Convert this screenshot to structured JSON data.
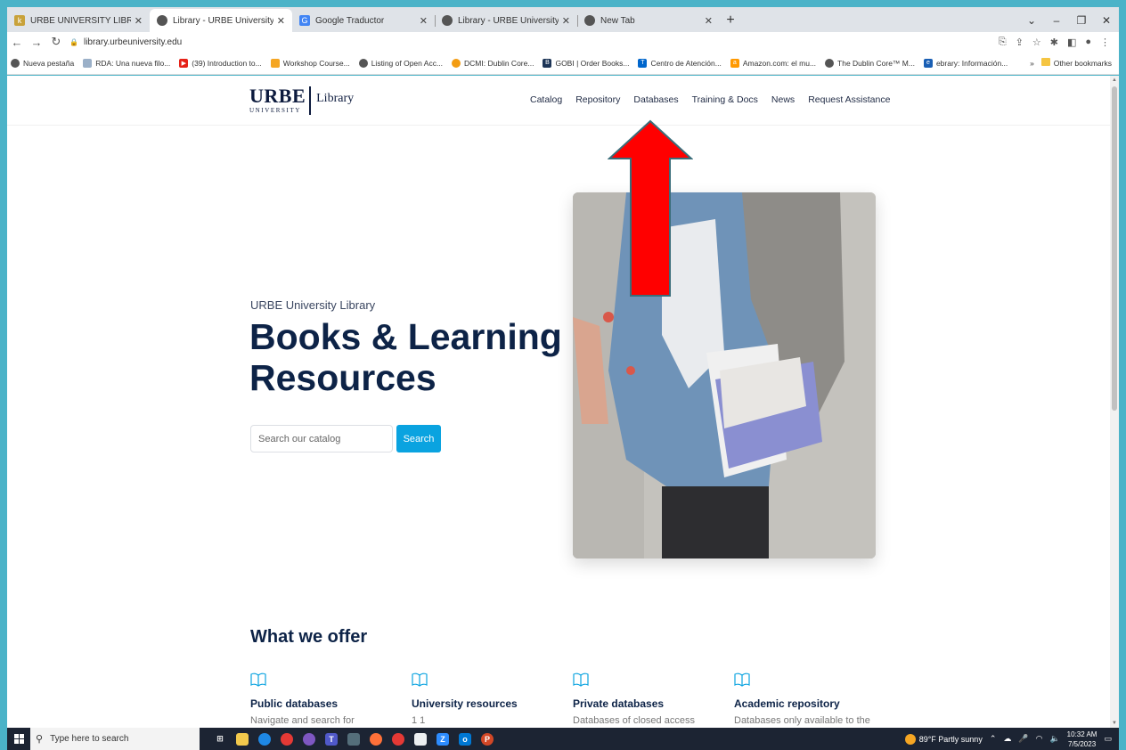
{
  "browser": {
    "tabs": [
      {
        "title": "URBE UNIVERSITY LIBRARY SYST",
        "icon": "k-favicon",
        "color": "#c8a23a",
        "active": false
      },
      {
        "title": "Library - URBE University",
        "icon": "globe-icon",
        "color": "#555555",
        "active": true
      },
      {
        "title": "Google Traductor",
        "icon": "translate-icon",
        "color": "#4285f4",
        "active": false
      },
      {
        "title": "Library - URBE University",
        "icon": "globe-icon",
        "color": "#555555",
        "active": false
      },
      {
        "title": "New Tab",
        "icon": "globe-icon",
        "color": "#555555",
        "active": false
      }
    ],
    "new_tab": "+",
    "address": "library.urbeuniversity.edu",
    "bookmarks": [
      {
        "label": "Nueva pestaña",
        "color": "#555555"
      },
      {
        "label": "RDA: Una nueva filo...",
        "color": "#9bb0c8"
      },
      {
        "label": "(39) Introduction to...",
        "color": "#e62117"
      },
      {
        "label": "Workshop Course...",
        "color": "#f5a623"
      },
      {
        "label": "Listing of Open Acc...",
        "color": "#555555"
      },
      {
        "label": "DCMI: Dublin Core...",
        "color": "#f39c12"
      },
      {
        "label": "GOBI | Order Books...",
        "color": "#1d3557"
      },
      {
        "label": "Centro de Atención...",
        "color": "#0066cc"
      },
      {
        "label": "Amazon.com: el mu...",
        "color": "#ff9900"
      },
      {
        "label": "The Dublin Core™ M...",
        "color": "#555555"
      },
      {
        "label": "ebrary: Información...",
        "color": "#1a5fb4"
      }
    ],
    "other_bookmarks": "Other bookmarks",
    "overflow": "»"
  },
  "site": {
    "logo": {
      "wordmark": "URBE",
      "sub": "UNIVERSITY",
      "library": "Library"
    },
    "nav": [
      "Catalog",
      "Repository",
      "Databases",
      "Training & Docs",
      "News",
      "Request Assistance"
    ],
    "hero": {
      "subtitle": "URBE University Library",
      "title": "Books & Learning Resources",
      "search_placeholder": "Search our catalog",
      "search_button": "Search"
    },
    "offer": {
      "heading": "What we offer",
      "items": [
        {
          "name": "Public databases",
          "desc": "Navigate and search for"
        },
        {
          "name": "University resources",
          "desc": "1 1"
        },
        {
          "name": "Private databases",
          "desc": "Databases of closed access"
        },
        {
          "name": "Academic repository",
          "desc": "Databases only available to the"
        }
      ]
    }
  },
  "annotation": {
    "arrow_color": "#ff0000"
  },
  "taskbar": {
    "search_placeholder": "Type here to search",
    "weather": "89°F  Partly sunny",
    "time": "10:32 AM",
    "date": "7/5/2023"
  }
}
